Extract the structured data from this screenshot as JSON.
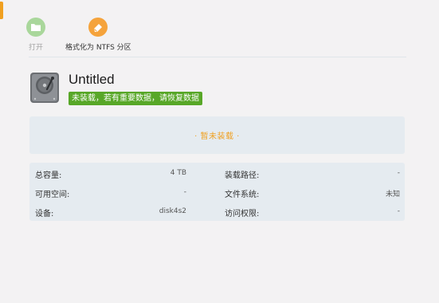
{
  "toolbar": {
    "open_label": "打开",
    "format_label": "格式化为 NTFS 分区",
    "open_icon": "folder-icon",
    "format_icon": "eraser-icon"
  },
  "disk": {
    "name": "Untitled",
    "badge": "未装载，若有重要数据，请恢复数据",
    "icon": "hard-drive-icon"
  },
  "mount_status": "· 暂未装载 ·",
  "info": {
    "rows": [
      {
        "left_label": "总容量:",
        "left_value": "4 TB",
        "right_label": "装载路径:",
        "right_value": "-"
      },
      {
        "left_label": "可用空间:",
        "left_value": "-",
        "right_label": "文件系统:",
        "right_value": "未知"
      },
      {
        "left_label": "设备:",
        "left_value": "disk4s2",
        "right_label": "访问权限:",
        "right_value": "-"
      }
    ]
  },
  "colors": {
    "accent_orange": "#f0a020",
    "badge_green": "#58a728",
    "panel_bg": "#e5ebf0"
  }
}
